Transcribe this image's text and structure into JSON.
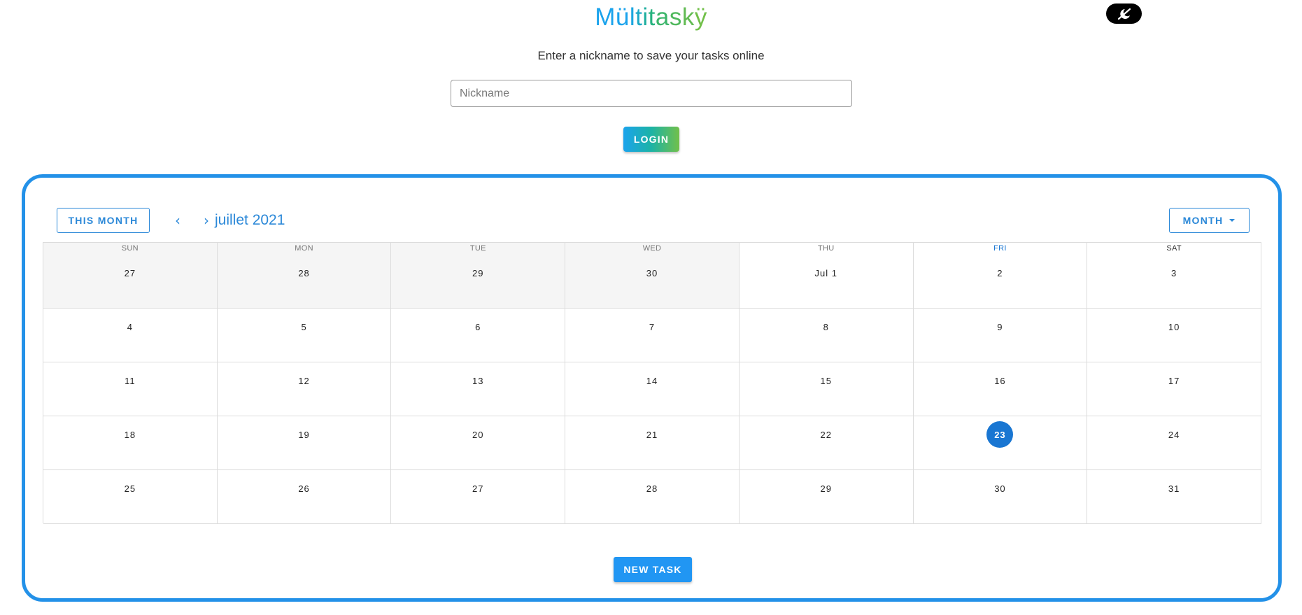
{
  "app": {
    "logo_letters": [
      {
        "ch": "M",
        "color": "#1ba3ec"
      },
      {
        "ch": "ü",
        "color": "#1ba3ec"
      },
      {
        "ch": "l",
        "color": "#1ba6e0"
      },
      {
        "ch": "t",
        "color": "#1ca9c6"
      },
      {
        "ch": "i",
        "color": "#1cae9e"
      },
      {
        "ch": "t",
        "color": "#26b27e"
      },
      {
        "ch": "a",
        "color": "#3cb56a"
      },
      {
        "ch": "s",
        "color": "#50b85d"
      },
      {
        "ch": "k",
        "color": "#62bb53"
      },
      {
        "ch": "ÿ",
        "color": "#72c04a"
      }
    ],
    "theme_toggle_icon": "no-moon-icon"
  },
  "login": {
    "prompt": "Enter a nickname to save your tasks online",
    "nickname_placeholder": "Nickname",
    "nickname_value": "",
    "login_label": "LOGIN"
  },
  "calendar": {
    "this_month_label": "THIS MONTH",
    "prev_icon": "‹",
    "next_icon": "›",
    "month_title": "juillet 2021",
    "view_label": "MONTH",
    "weekdays": [
      "SUN",
      "MON",
      "TUE",
      "WED",
      "THU",
      "FRI",
      "SAT"
    ],
    "today_weekday_index": 5,
    "weeks": [
      [
        {
          "d": "27",
          "out": true
        },
        {
          "d": "28",
          "out": true
        },
        {
          "d": "29",
          "out": true
        },
        {
          "d": "30",
          "out": true
        },
        {
          "d": "Jul 1"
        },
        {
          "d": "2"
        },
        {
          "d": "3"
        }
      ],
      [
        {
          "d": "4"
        },
        {
          "d": "5"
        },
        {
          "d": "6"
        },
        {
          "d": "7"
        },
        {
          "d": "8"
        },
        {
          "d": "9"
        },
        {
          "d": "10"
        }
      ],
      [
        {
          "d": "11"
        },
        {
          "d": "12"
        },
        {
          "d": "13"
        },
        {
          "d": "14"
        },
        {
          "d": "15"
        },
        {
          "d": "16"
        },
        {
          "d": "17"
        }
      ],
      [
        {
          "d": "18"
        },
        {
          "d": "19"
        },
        {
          "d": "20"
        },
        {
          "d": "21"
        },
        {
          "d": "22"
        },
        {
          "d": "23",
          "today": true
        },
        {
          "d": "24"
        }
      ],
      [
        {
          "d": "25"
        },
        {
          "d": "26"
        },
        {
          "d": "27"
        },
        {
          "d": "28"
        },
        {
          "d": "29"
        },
        {
          "d": "30"
        },
        {
          "d": "31"
        }
      ]
    ],
    "new_task_label": "NEW TASK"
  },
  "colors": {
    "accent": "#2391e8",
    "today": "#1976d2",
    "outside_month_bg": "#f5f5f5"
  }
}
